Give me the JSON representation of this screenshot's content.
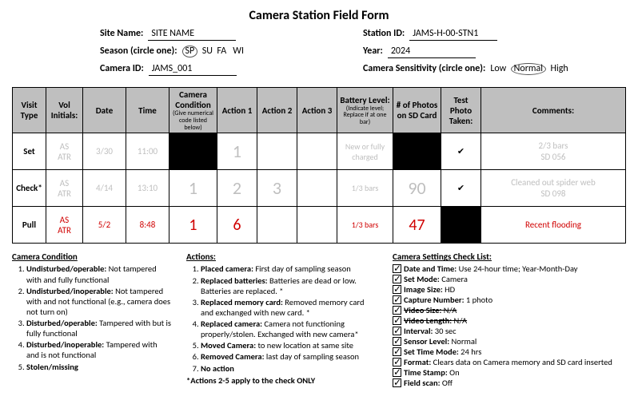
{
  "title": "Camera Station Field Form",
  "header": {
    "site_name_label": "Site Name:",
    "site_name": "SITE NAME",
    "station_id_label": "Station ID:",
    "station_id": "JAMS-H-00-STN1",
    "season_label": "Season (circle one):",
    "season_sp": "SP",
    "season_su": "SU",
    "season_fa": "FA",
    "season_wi": "WI",
    "year_label": "Year:",
    "year": "2024",
    "camera_id_label": "Camera ID:",
    "camera_id": "JAMS_001",
    "sensitivity_label": "Camera Sensitivity (circle one):",
    "sens_low": "Low",
    "sens_normal": "Normal",
    "sens_high": "High"
  },
  "table": {
    "headers": {
      "visit": "Visit Type",
      "vol": "Vol Initials:",
      "date": "Date",
      "time": "Time",
      "cond": "Camera Condition",
      "cond_sub": "(Give numerical code listed below)",
      "a1": "Action 1",
      "a2": "Action 2",
      "a3": "Action 3",
      "battery": "Battery Level:",
      "battery_sub": "(Indicate level; Replace if at one bar)",
      "photos": "# of Photos on SD Card",
      "test": "Test Photo Taken:",
      "comments": "Comments:"
    },
    "rows": [
      {
        "visit": "Set",
        "cls": "example",
        "vol": "AS\nATR",
        "date": "3/30",
        "time": "11:00",
        "cond": "",
        "cond_black": true,
        "a1": "1",
        "a2": "",
        "a3": "",
        "battery": "New or fully charged",
        "photos": "",
        "photos_black": true,
        "test": "✔",
        "comments": "2/3 bars\nSD 056"
      },
      {
        "visit": "Check*",
        "cls": "example",
        "vol": "AS\nATR",
        "date": "4/14",
        "time": "13:10",
        "cond": "1",
        "cond_black": false,
        "a1": "2",
        "a2": "3",
        "a3": "",
        "battery": "1/3 bars",
        "photos": "90",
        "photos_black": false,
        "test": "✔",
        "comments": "Cleaned out spider web\nSD 098"
      },
      {
        "visit": "Pull",
        "cls": "red",
        "vol": "AS\nATR",
        "date": "5/2",
        "time": "8:48",
        "cond": "1",
        "cond_black": false,
        "a1": "6",
        "a2": "",
        "a3": "",
        "battery": "1/3 bars",
        "photos": "47",
        "photos_black": false,
        "test": "",
        "test_black": true,
        "comments": "Recent flooding"
      }
    ]
  },
  "legend": {
    "cond_title": "Camera Condition",
    "cond": [
      {
        "b": "Undisturbed/operable:",
        "t": " Not tampered with and fully functional"
      },
      {
        "b": "Undisturbed/inoperable:",
        "t": " Not tampered with and not functional (e.g., camera does not turn on)"
      },
      {
        "b": "Disturbed/operable:",
        "t": " Tampered with but is fully functional"
      },
      {
        "b": "Disturbed/inoperable:",
        "t": " Tampered with and is not functional"
      },
      {
        "b": "Stolen/missing",
        "t": ""
      }
    ],
    "act_title": "Actions:",
    "act": [
      {
        "b": "Placed camera:",
        "t": " First day of sampling season"
      },
      {
        "b": "Replaced batteries:",
        "t": " Batteries are dead or low. Batteries are replaced. *"
      },
      {
        "b": "Replaced memory card:",
        "t": " Removed memory card and exchanged with new card. *"
      },
      {
        "b": "Replaced camera:",
        "t": " Camera not functioning properly/stolen. Exchanged with new camera*"
      },
      {
        "b": "Moved Camera:",
        "t": " to new location at same site"
      },
      {
        "b": "Removed Camera:",
        "t": " last day of sampling season"
      },
      {
        "b": "No action",
        "t": ""
      }
    ],
    "act_note": "*Actions 2-5 apply to the check ONLY",
    "check_title": "Camera Settings Check List:",
    "checks": [
      {
        "on": true,
        "b": "Date and Time:",
        "t": " Use 24-hour time; Year-Month-Day"
      },
      {
        "on": true,
        "b": "Set Mode:",
        "t": " Camera"
      },
      {
        "on": true,
        "b": "Image Size:",
        "t": " HD"
      },
      {
        "on": true,
        "b": "Capture Number:",
        "t": " 1 photo"
      },
      {
        "on": true,
        "b": "Video Size:",
        "t": " N/A",
        "strike": true
      },
      {
        "on": true,
        "b": "Video Length:",
        "t": " N/A",
        "strike": true
      },
      {
        "on": true,
        "b": "Interval:",
        "t": " 30 sec"
      },
      {
        "on": true,
        "b": "Sensor Level:",
        "t": " Normal"
      },
      {
        "on": true,
        "b": "Set Time Mode:",
        "t": " 24 hrs"
      },
      {
        "on": true,
        "b": "Format:",
        "t": " Clears data on Camera memory and SD card inserted"
      },
      {
        "on": true,
        "b": "Time Stamp:",
        "t": " On"
      },
      {
        "on": true,
        "b": "Field scan:",
        "t": " Off"
      }
    ]
  }
}
